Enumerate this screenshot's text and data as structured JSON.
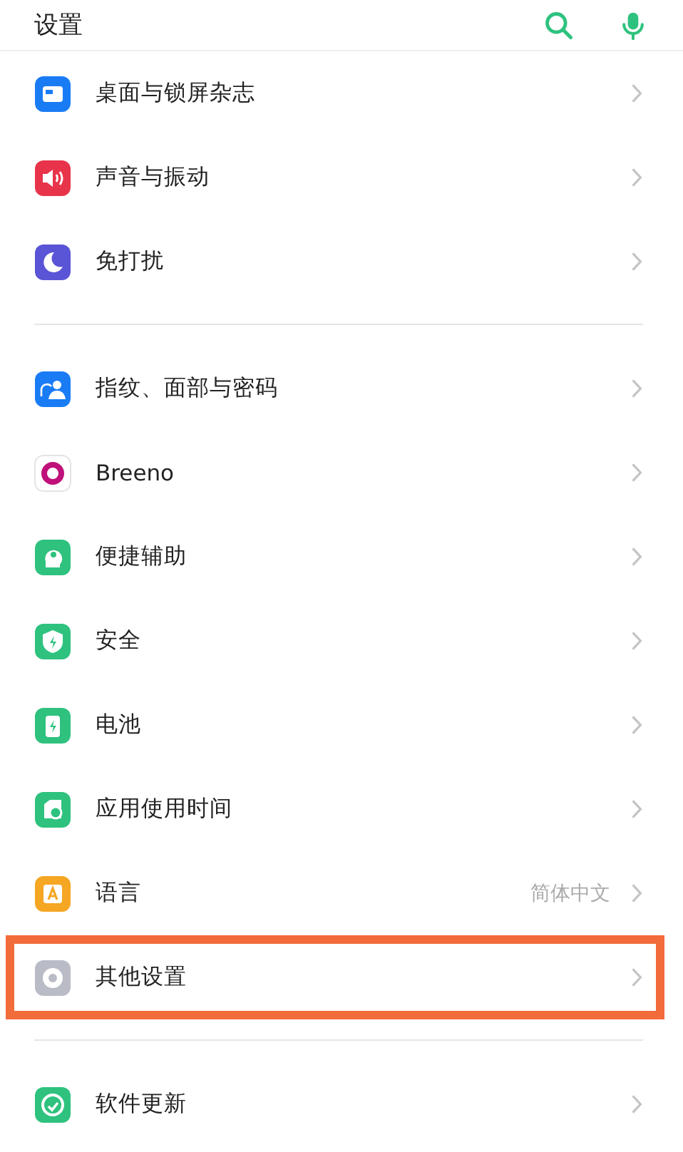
{
  "header": {
    "title": "设置"
  },
  "groups": [
    {
      "items": [
        {
          "label": "桌面与锁屏杂志",
          "highlighted": false
        },
        {
          "label": "声音与振动",
          "highlighted": false
        },
        {
          "label": "免打扰",
          "highlighted": false
        }
      ]
    },
    {
      "items": [
        {
          "label": "指纹、面部与密码",
          "highlighted": false
        },
        {
          "label": "Breeno",
          "highlighted": false
        },
        {
          "label": "便捷辅助",
          "highlighted": false
        },
        {
          "label": "安全",
          "highlighted": false
        },
        {
          "label": "电池",
          "highlighted": false
        },
        {
          "label": "应用使用时间",
          "highlighted": false
        },
        {
          "label": "语言",
          "value": "简体中文",
          "highlighted": false
        },
        {
          "label": "其他设置",
          "highlighted": true
        }
      ]
    },
    {
      "items": [
        {
          "label": "软件更新",
          "highlighted": false
        }
      ]
    }
  ]
}
